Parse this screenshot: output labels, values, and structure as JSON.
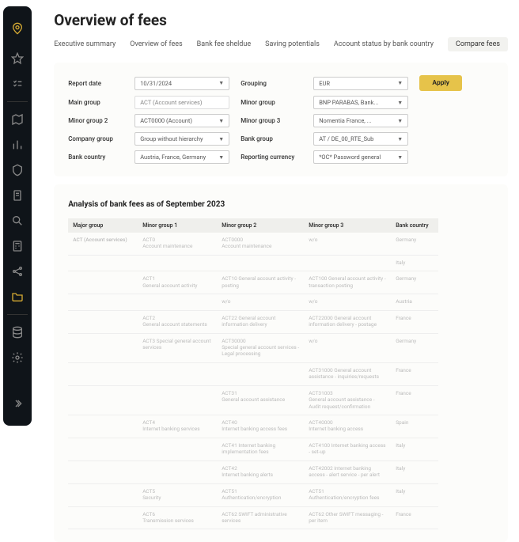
{
  "page": {
    "title": "Overview of fees"
  },
  "tabs": {
    "t0": "Executive summary",
    "t1": "Overview of fees",
    "t2": "Bank fee sheldue",
    "t3": "Saving potentials",
    "t4": "Account status by bank country",
    "t5": "Compare fees"
  },
  "filters": {
    "report_date": {
      "label": "Report date",
      "value": "10/31/2024"
    },
    "grouping": {
      "label": "Grouping",
      "value": "EUR"
    },
    "main_group": {
      "label": "Main group",
      "value": "ACT (Account services)"
    },
    "minor_group": {
      "label": "Minor group",
      "value": "BNP PARABAS, Bank..."
    },
    "minor_group_2": {
      "label": "Minor group 2",
      "value": "ACT0000 (Account)"
    },
    "minor_group_3": {
      "label": "Minor group 3",
      "value": "Nomentia France, ..."
    },
    "company_group": {
      "label": "Company group",
      "value": "Group without hierarchy"
    },
    "bank_group": {
      "label": "Bank group",
      "value": "AT / DE_00_RTE_Sub"
    },
    "bank_country": {
      "label": "Bank country",
      "value": "Austria, France, Germany"
    },
    "reporting_currency": {
      "label": "Reporting currency",
      "value": "*OC* Password general"
    },
    "apply": "Apply"
  },
  "analysis": {
    "title": "Analysis of bank fees as of September 2023",
    "headers": {
      "h0": "Major group",
      "h1": "Minor group 1",
      "h2": "Minor group 2",
      "h3": "Minor group 3",
      "h4": "Bank country"
    },
    "rows": [
      {
        "major": "ACT (Account services)",
        "m1": "ACT0\nAccount maintenance",
        "m2": "ACT0000\nAccount maintenance",
        "m3": "w/o",
        "country": "Germany"
      },
      {
        "major": "",
        "m1": "",
        "m2": "",
        "m3": "",
        "country": "Italy"
      },
      {
        "major": "",
        "m1": "ACT1\nGeneral account activity",
        "m2": "ACT10 General account activity - posting",
        "m3": "ACT100 General account activity - transaction posting",
        "country": "Germany"
      },
      {
        "major": "",
        "m1": "",
        "m2": "w/o",
        "m3": "w/o",
        "country": "Austria"
      },
      {
        "major": "",
        "m1": "ACT2\nGeneral account statements",
        "m2": "ACT22 General account information delivery",
        "m3": "ACT22000 General account information delivery - postage",
        "country": "France"
      },
      {
        "major": "",
        "m1": "ACT3 Special general account services",
        "m2": "ACT30000\nSpecial general account services -Legal processing",
        "m3": "w/o",
        "country": "Germany"
      },
      {
        "major": "",
        "m1": "",
        "m2": "",
        "m3": "ACT31000 General account assistance - inquiries/requests",
        "country": "France"
      },
      {
        "major": "",
        "m1": "",
        "m2": "ACT31\nGeneral account assistance",
        "m3": "ACT31003\nGeneral account assistance - Audit request/confirmation",
        "country": "France"
      },
      {
        "major": "",
        "m1": "ACT4\nInternet banking services",
        "m2": "ACT40\nInternet banking access fees",
        "m3": "ACT40000\nInternet banking access",
        "country": "Spain"
      },
      {
        "major": "",
        "m1": "",
        "m2": "ACT41 Internet banking implementation fees",
        "m3": "ACT4100 Internet banking access - set-up",
        "country": "Italy"
      },
      {
        "major": "",
        "m1": "",
        "m2": "ACT42\nInternet banking alerts",
        "m3": "ACT42002 Internet banking access - alert service - per alert",
        "country": "Italy"
      },
      {
        "major": "",
        "m1": "ACT5\nSecurity",
        "m2": "ACT51\nAuthentication/encryption",
        "m3": "ACT51\nAuthentication/encryption fees",
        "country": "Italy"
      },
      {
        "major": "",
        "m1": "ACT6\nTransmission services",
        "m2": "ACT62 SWIFT administrative services",
        "m3": "ACT62 Other SWIFT messaging - per item",
        "country": "France"
      }
    ]
  }
}
